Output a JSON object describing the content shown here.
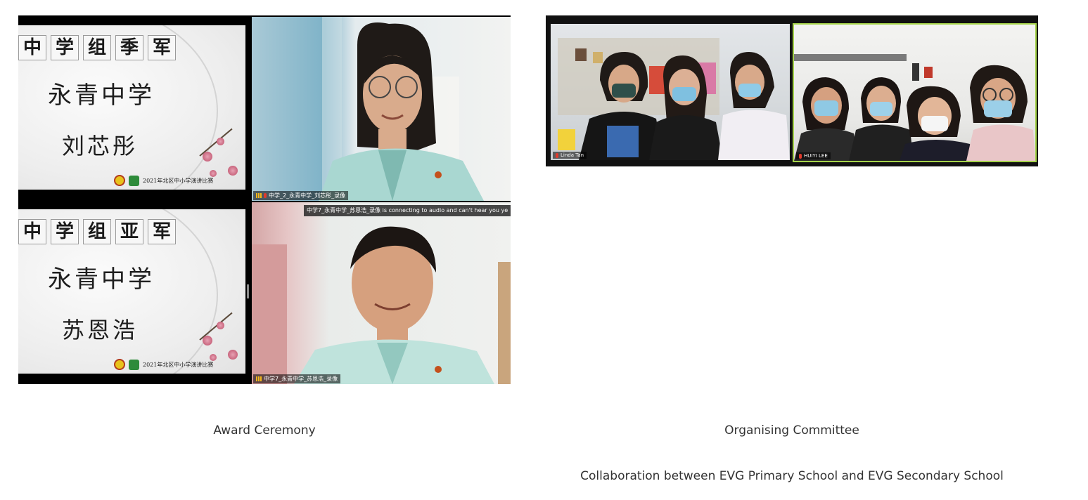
{
  "left_photo": {
    "slide_top": {
      "award_chars": [
        "中",
        "学",
        "组",
        "季",
        "军"
      ],
      "school": "永青中学",
      "winner": "刘芯彤",
      "footer": "2021年北区中小学演讲比赛"
    },
    "slide_bottom": {
      "award_chars": [
        "中",
        "学",
        "组",
        "亚",
        "军"
      ],
      "school": "永青中学",
      "winner": "苏恩浩",
      "footer": "2021年北区中小学演讲比赛"
    },
    "cam_top_label": "中学_2_永青中学_刘芯彤_录像",
    "cam_bottom_label": "中学7_永青中学_苏恩浩_录像",
    "notification": "中学7_永青中学_苏恩浩_录像 is connecting to audio and can't hear you ye"
  },
  "right_photo": {
    "tile_left_label": "Linda Tan",
    "tile_right_label": "HUIYI LEE"
  },
  "captions": {
    "left": "Award Ceremony",
    "right": "Organising Committee",
    "right_sub": "Collaboration between EVG Primary School and EVG Secondary School"
  }
}
